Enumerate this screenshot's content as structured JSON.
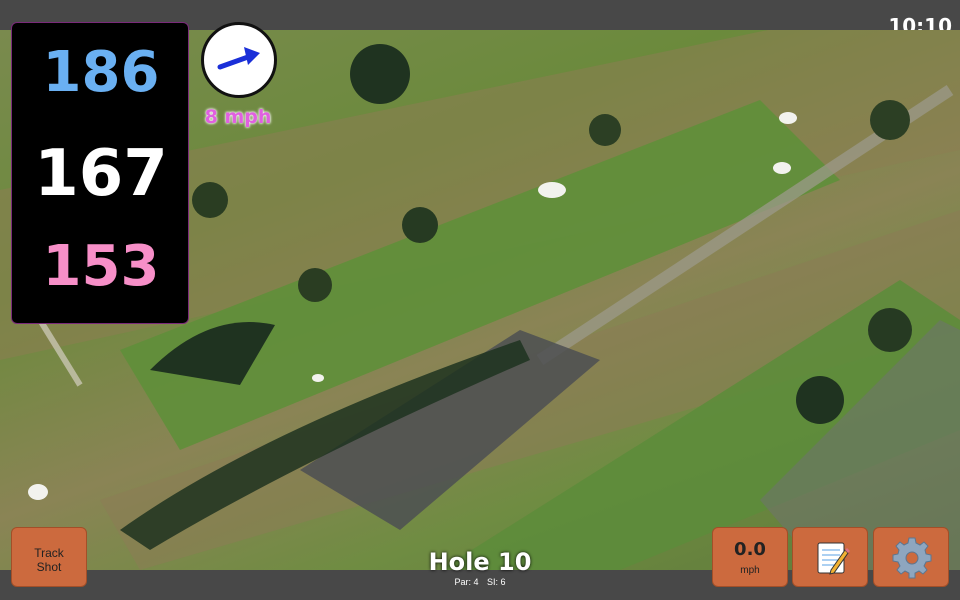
{
  "status_bar": {
    "time": "10:10"
  },
  "distances": {
    "back": "186",
    "center": "167",
    "front": "153",
    "colors": {
      "back": "#6ab0f2",
      "center": "#ffffff",
      "front": "#f78fc8"
    }
  },
  "wind": {
    "speed_label": "8 mph",
    "arrow_icon": "wind-direction-arrow"
  },
  "buttons": {
    "track_shot": "Track\nShot",
    "speed_value": "0.0",
    "speed_unit": "mph",
    "notes_icon": "notepad-icon",
    "settings_icon": "gear-icon"
  },
  "hole": {
    "title": "Hole 10",
    "par": "Par: 4",
    "si": "SI: 6"
  }
}
